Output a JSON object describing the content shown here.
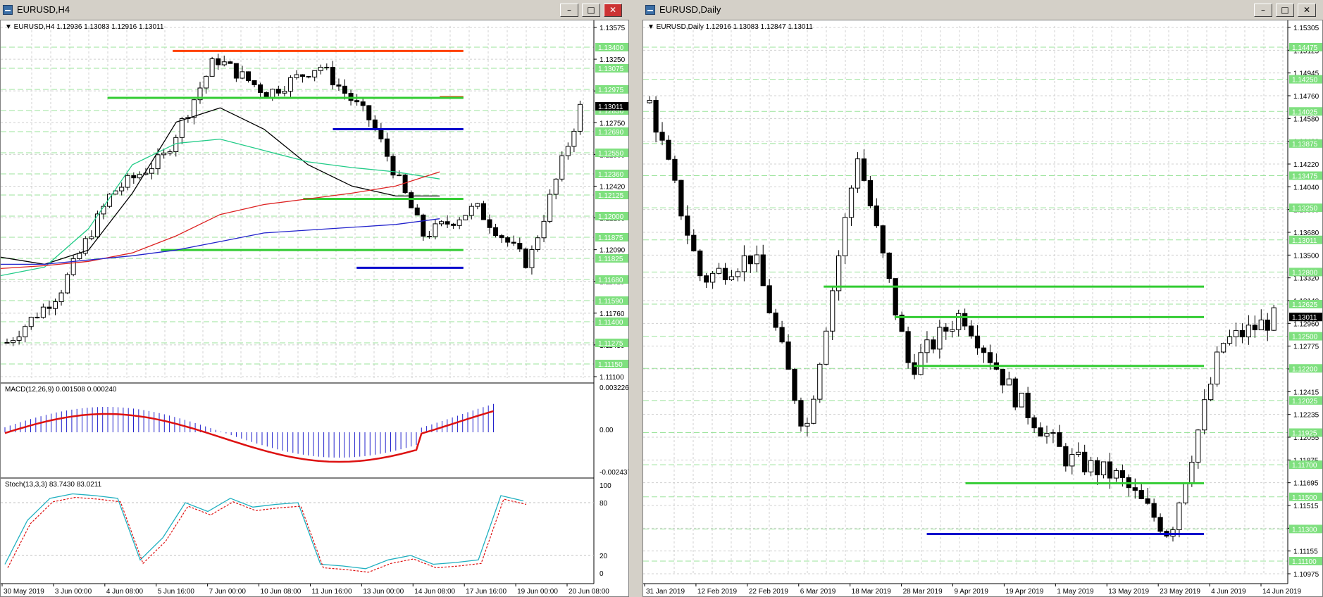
{
  "windows": [
    {
      "title": "EURUSD,H4",
      "header_text": "EURUSD,H4  1.12936 1.13083 1.12916 1.13011",
      "price_ticks": [
        "1.13575",
        "1.13250",
        "1.12915",
        "1.12750",
        "1.12585",
        "1.12420",
        "1.12255",
        "1.12090",
        "1.11925",
        "1.11760",
        "1.11430",
        "1.11100"
      ],
      "level_labels": [
        "1.13400",
        "1.13075",
        "1.12975",
        "1.12850",
        "1.12690",
        "1.12550",
        "1.12360",
        "1.12125",
        "1.12000",
        "1.11875",
        "1.11825",
        "1.11680",
        "1.11590",
        "1.11400",
        "1.11275",
        "1.11150"
      ],
      "current_price": "1.13011",
      "macd_label": "MACD(12,26,9) 0.001508 0.000240",
      "macd_ticks": [
        "0.003226",
        "0.00",
        "-0.002437"
      ],
      "stoch_label": "Stoch(13,3,3) 83.7430 83.0211",
      "stoch_ticks": [
        "100",
        "80",
        "20",
        "0"
      ],
      "time_labels": [
        "30 May 2019",
        "3 Jun 00:00",
        "4 Jun 08:00",
        "5 Jun 16:00",
        "7 Jun 00:00",
        "10 Jun 08:00",
        "11 Jun 16:00",
        "13 Jun 00:00",
        "14 Jun 08:00",
        "17 Jun 16:00",
        "19 Jun 00:00",
        "20 Jun 08:00"
      ]
    },
    {
      "title": "EURUSD,Daily",
      "header_text": "EURUSD,Daily  1.12916 1.13083 1.12847 1.13011",
      "price_ticks": [
        "1.15305",
        "1.15125",
        "1.14945",
        "1.14760",
        "1.14580",
        "1.14400",
        "1.14220",
        "1.14040",
        "1.13860",
        "1.13680",
        "1.13500",
        "1.13320",
        "1.13140",
        "1.12960",
        "1.12775",
        "1.12595",
        "1.12415",
        "1.12235",
        "1.12055",
        "1.11875",
        "1.11695",
        "1.11515",
        "1.11335",
        "1.11155",
        "1.10975"
      ],
      "level_labels": [
        "1.14475",
        "1.14250",
        "1.14025",
        "1.13875",
        "1.13475",
        "1.13250",
        "1.13011",
        "1.12800",
        "1.12625",
        "1.12500",
        "1.12200",
        "1.12025",
        "1.11925",
        "1.11700",
        "1.11500",
        "1.11300",
        "1.11100"
      ],
      "current_price": "1.13011",
      "time_labels": [
        "31 Jan 2019",
        "12 Feb 2019",
        "22 Feb 2019",
        "6 Mar 2019",
        "18 Mar 2019",
        "28 Mar 2019",
        "9 Apr 2019",
        "19 Apr 2019",
        "1 May 2019",
        "13 May 2019",
        "23 May 2019",
        "4 Jun 2019",
        "14 Jun 2019"
      ]
    }
  ],
  "chart_data": [
    {
      "type": "line",
      "title": "EURUSD,H4",
      "ohlc_header": {
        "open": 1.12936,
        "high": 1.13083,
        "low": 1.12916,
        "close": 1.13011
      },
      "x": [
        "30 May 2019",
        "3 Jun 00:00",
        "4 Jun 08:00",
        "5 Jun 16:00",
        "7 Jun 00:00",
        "10 Jun 08:00",
        "11 Jun 16:00",
        "13 Jun 00:00",
        "14 Jun 08:00",
        "17 Jun 16:00",
        "19 Jun 00:00",
        "20 Jun 08:00"
      ],
      "series": [
        {
          "values": [
            1.1135,
            1.117,
            1.124,
            1.1265,
            1.1335,
            1.131,
            1.133,
            1.129,
            1.121,
            1.123,
            1.119,
            1.13
          ]
        }
      ],
      "horizontal_levels": [
        {
          "price": 1.134,
          "color": "#ff4000"
        },
        {
          "price": 1.13075,
          "color": "#e04000"
        },
        {
          "price": 1.1307,
          "color": "#33cc33"
        },
        {
          "price": 1.1285,
          "color": "#0000cc"
        },
        {
          "price": 1.1236,
          "color": "#33cc33"
        },
        {
          "price": 1.12,
          "color": "#33cc33"
        },
        {
          "price": 1.11875,
          "color": "#0000cc"
        }
      ],
      "ylim": [
        1.111,
        1.13575
      ],
      "macd": {
        "label": "MACD(12,26,9) 0.001508 0.000240",
        "range": [
          -0.002437,
          0.003226
        ]
      },
      "stochastic": {
        "label": "Stoch(13,3,3) 83.7430 83.0211",
        "range": [
          0,
          100
        ],
        "levels": [
          20,
          80
        ]
      }
    },
    {
      "type": "line",
      "title": "EURUSD,Daily",
      "ohlc_header": {
        "open": 1.12916,
        "high": 1.13083,
        "low": 1.12847,
        "close": 1.13011
      },
      "x": [
        "31 Jan 2019",
        "12 Feb 2019",
        "22 Feb 2019",
        "6 Mar 2019",
        "18 Mar 2019",
        "28 Mar 2019",
        "9 Apr 2019",
        "19 Apr 2019",
        "1 May 2019",
        "13 May 2019",
        "23 May 2019",
        "4 Jun 2019",
        "14 Jun 2019"
      ],
      "series": [
        {
          "values": [
            1.147,
            1.133,
            1.135,
            1.121,
            1.143,
            1.126,
            1.1305,
            1.124,
            1.119,
            1.1175,
            1.113,
            1.128,
            1.13
          ]
        }
      ],
      "horizontal_levels": [
        {
          "price": 1.1325,
          "color": "#33cc33"
        },
        {
          "price": 1.1301,
          "color": "#33cc33"
        },
        {
          "price": 1.12625,
          "color": "#33cc33"
        },
        {
          "price": 1.117,
          "color": "#33cc33"
        },
        {
          "price": 1.113,
          "color": "#0000cc"
        }
      ],
      "ylim": [
        1.10975,
        1.15305
      ]
    }
  ]
}
